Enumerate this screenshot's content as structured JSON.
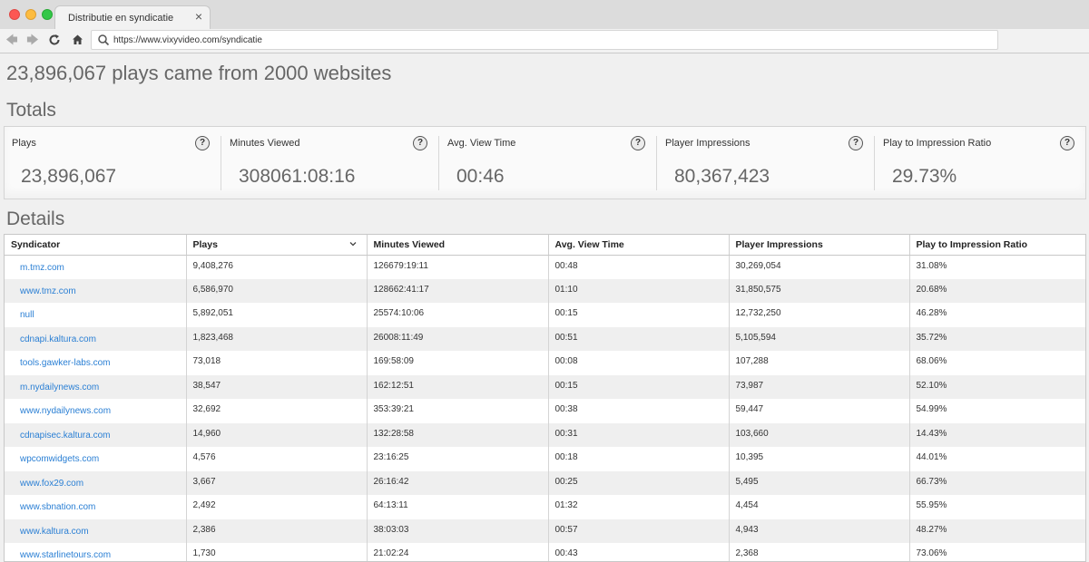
{
  "browser": {
    "tab_title": "Distributie en syndicatie",
    "tab_close": "×",
    "url": "https://www.vixyvideo.com/syndicatie"
  },
  "headline": "23,896,067 plays came from 2000 websites",
  "totals": {
    "title": "Totals",
    "items": [
      {
        "label": "Plays",
        "value": "23,896,067"
      },
      {
        "label": "Minutes Viewed",
        "value": "308061:08:16"
      },
      {
        "label": "Avg. View Time",
        "value": "00:46"
      },
      {
        "label": "Player Impressions",
        "value": "80,367,423"
      },
      {
        "label": "Play to Impression Ratio",
        "value": "29.73%"
      }
    ],
    "help_glyph": "?"
  },
  "details": {
    "title": "Details",
    "sorted_column": "Plays",
    "columns": [
      "Syndicator",
      "Plays",
      "Minutes Viewed",
      "Avg. View Time",
      "Player Impressions",
      "Play to Impression Ratio"
    ],
    "rows": [
      [
        "m.tmz.com",
        "9,408,276",
        "126679:19:11",
        "00:48",
        "30,269,054",
        "31.08%"
      ],
      [
        "www.tmz.com",
        "6,586,970",
        "128662:41:17",
        "01:10",
        "31,850,575",
        "20.68%"
      ],
      [
        "null",
        "5,892,051",
        "25574:10:06",
        "00:15",
        "12,732,250",
        "46.28%"
      ],
      [
        "cdnapi.kaltura.com",
        "1,823,468",
        "26008:11:49",
        "00:51",
        "5,105,594",
        "35.72%"
      ],
      [
        "tools.gawker-labs.com",
        "73,018",
        "169:58:09",
        "00:08",
        "107,288",
        "68.06%"
      ],
      [
        "m.nydailynews.com",
        "38,547",
        "162:12:51",
        "00:15",
        "73,987",
        "52.10%"
      ],
      [
        "www.nydailynews.com",
        "32,692",
        "353:39:21",
        "00:38",
        "59,447",
        "54.99%"
      ],
      [
        "cdnapisec.kaltura.com",
        "14,960",
        "132:28:58",
        "00:31",
        "103,660",
        "14.43%"
      ],
      [
        "wpcomwidgets.com",
        "4,576",
        "23:16:25",
        "00:18",
        "10,395",
        "44.01%"
      ],
      [
        "www.fox29.com",
        "3,667",
        "26:16:42",
        "00:25",
        "5,495",
        "66.73%"
      ],
      [
        "www.sbnation.com",
        "2,492",
        "64:13:11",
        "01:32",
        "4,454",
        "55.95%"
      ],
      [
        "www.kaltura.com",
        "2,386",
        "38:03:03",
        "00:57",
        "4,943",
        "48.27%"
      ],
      [
        "www.starlinetours.com",
        "1,730",
        "21:02:24",
        "00:43",
        "2,368",
        "73.06%"
      ]
    ]
  },
  "colors": {
    "link": "#2a7fd4",
    "row_alt": "#efefef",
    "value_text": "#666666"
  }
}
